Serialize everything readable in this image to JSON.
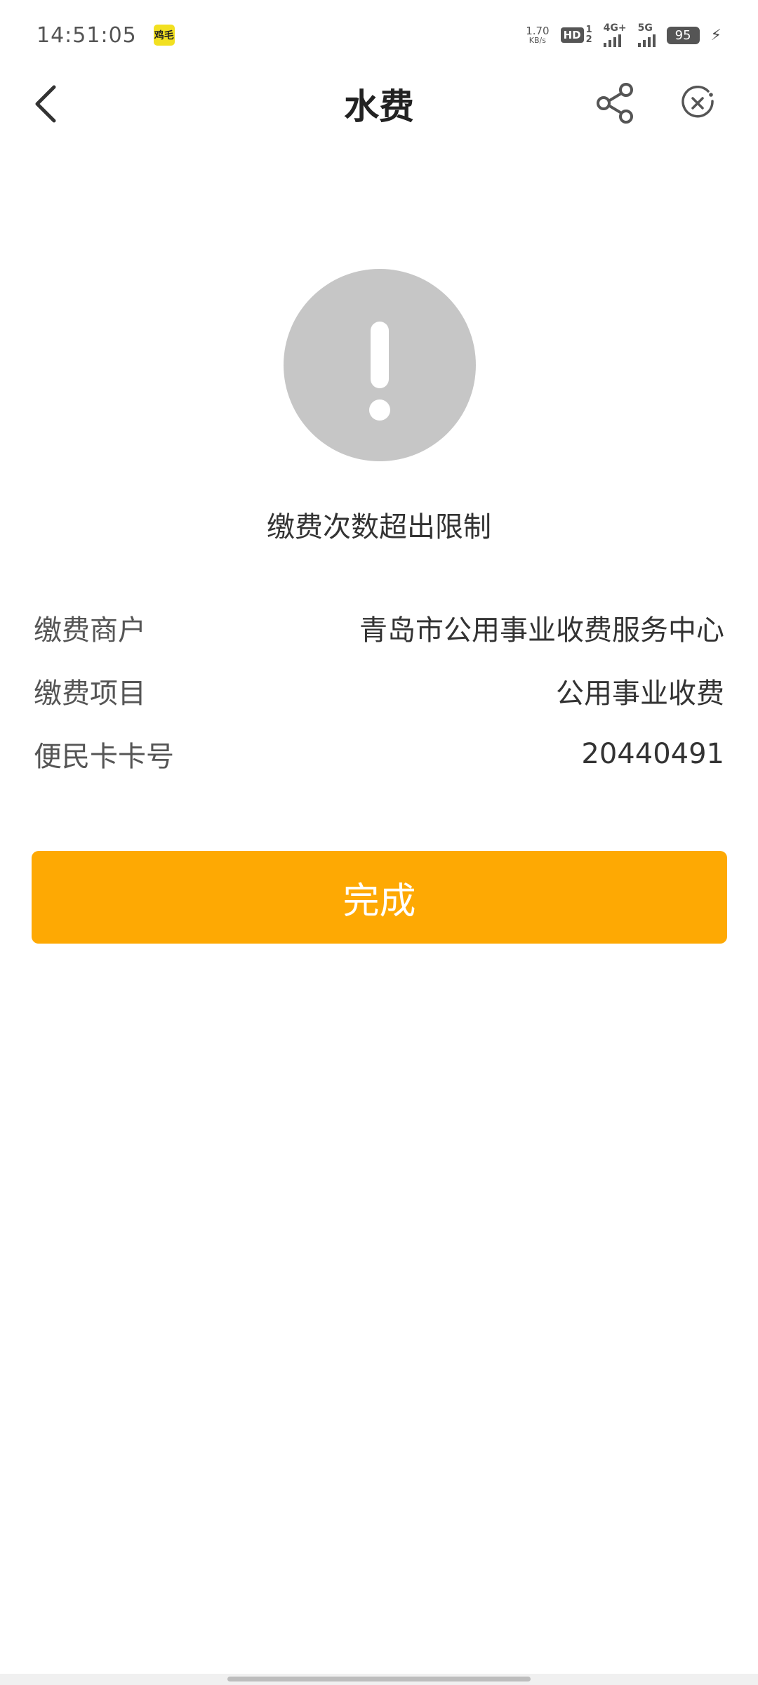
{
  "status_bar": {
    "time": "14:51:05",
    "app_badge": "鸡毛",
    "net_speed_value": "1.70",
    "net_speed_unit": "KB/s",
    "hd_label": "HD",
    "hd_sim_top": "1",
    "hd_sim_bottom": "2",
    "signal_1_label": "4G+",
    "signal_2_label": "5G",
    "battery": "95",
    "charging_icon": "bolt-icon"
  },
  "navbar": {
    "title": "水费",
    "back_icon": "chevron-left-icon",
    "share_icon": "share-icon",
    "close_icon": "close-circle-icon"
  },
  "result": {
    "icon": "exclamation-icon",
    "icon_color": "#c6c6c6",
    "message": "缴费次数超出限制"
  },
  "details": [
    {
      "label": "缴费商户",
      "value": "青岛市公用事业收费服务中心"
    },
    {
      "label": "缴费项目",
      "value": "公用事业收费"
    },
    {
      "label": "便民卡卡号",
      "value": "20440491"
    }
  ],
  "done_button": {
    "label": "完成",
    "color": "#fea903"
  }
}
